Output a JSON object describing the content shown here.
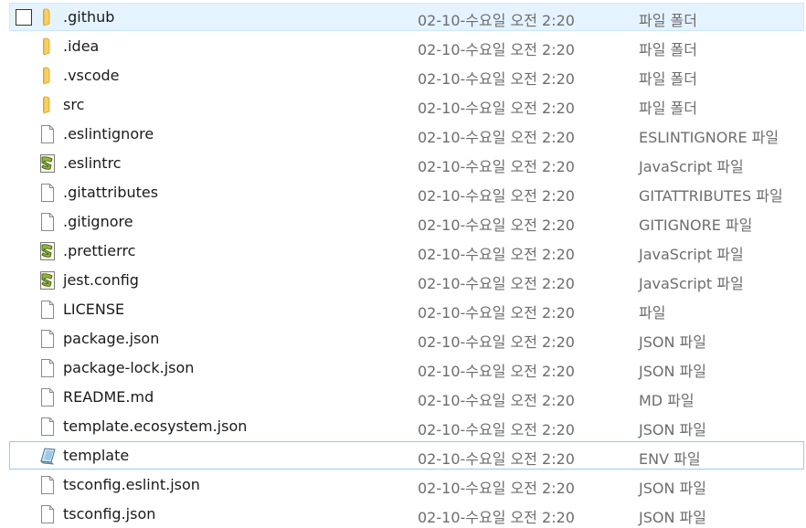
{
  "file_list": {
    "rows": [
      {
        "name": ".github",
        "date": "02-10-수요일 오전 2:20",
        "type": "파일 폴더",
        "icon": "folder-icon",
        "state": "selected-checkbox"
      },
      {
        "name": ".idea",
        "date": "02-10-수요일 오전 2:20",
        "type": "파일 폴더",
        "icon": "folder-icon",
        "state": ""
      },
      {
        "name": ".vscode",
        "date": "02-10-수요일 오전 2:20",
        "type": "파일 폴더",
        "icon": "folder-icon",
        "state": ""
      },
      {
        "name": "src",
        "date": "02-10-수요일 오전 2:20",
        "type": "파일 폴더",
        "icon": "folder-icon",
        "state": ""
      },
      {
        "name": ".eslintignore",
        "date": "02-10-수요일 오전 2:20",
        "type": "ESLINTIGNORE 파일",
        "icon": "blank-file-icon",
        "state": ""
      },
      {
        "name": ".eslintrc",
        "date": "02-10-수요일 오전 2:20",
        "type": "JavaScript 파일",
        "icon": "script-file-icon",
        "state": ""
      },
      {
        "name": ".gitattributes",
        "date": "02-10-수요일 오전 2:20",
        "type": "GITATTRIBUTES 파일",
        "icon": "blank-file-icon",
        "state": ""
      },
      {
        "name": ".gitignore",
        "date": "02-10-수요일 오전 2:20",
        "type": "GITIGNORE 파일",
        "icon": "blank-file-icon",
        "state": ""
      },
      {
        "name": ".prettierrc",
        "date": "02-10-수요일 오전 2:20",
        "type": "JavaScript 파일",
        "icon": "script-file-icon",
        "state": ""
      },
      {
        "name": "jest.config",
        "date": "02-10-수요일 오전 2:20",
        "type": "JavaScript 파일",
        "icon": "script-file-icon",
        "state": ""
      },
      {
        "name": "LICENSE",
        "date": "02-10-수요일 오전 2:20",
        "type": "파일",
        "icon": "blank-file-icon",
        "state": ""
      },
      {
        "name": "package.json",
        "date": "02-10-수요일 오전 2:20",
        "type": "JSON 파일",
        "icon": "blank-file-icon",
        "state": ""
      },
      {
        "name": "package-lock.json",
        "date": "02-10-수요일 오전 2:20",
        "type": "JSON 파일",
        "icon": "blank-file-icon",
        "state": ""
      },
      {
        "name": "README.md",
        "date": "02-10-수요일 오전 2:20",
        "type": "MD 파일",
        "icon": "blank-file-icon",
        "state": ""
      },
      {
        "name": "template.ecosystem.json",
        "date": "02-10-수요일 오전 2:20",
        "type": "JSON 파일",
        "icon": "blank-file-icon",
        "state": ""
      },
      {
        "name": "template",
        "date": "02-10-수요일 오전 2:20",
        "type": "ENV 파일",
        "icon": "env-file-icon",
        "state": "focused"
      },
      {
        "name": "tsconfig.eslint.json",
        "date": "02-10-수요일 오전 2:20",
        "type": "JSON 파일",
        "icon": "blank-file-icon",
        "state": ""
      },
      {
        "name": "tsconfig.json",
        "date": "02-10-수요일 오전 2:20",
        "type": "JSON 파일",
        "icon": "blank-file-icon",
        "state": ""
      }
    ]
  },
  "colors": {
    "selected_background": "#e5f3ff",
    "selected_border": "#cce8ff",
    "focus_border": "#99c9ef",
    "folder": "#f0c24b",
    "secondary_text": "#6d6d6d"
  }
}
